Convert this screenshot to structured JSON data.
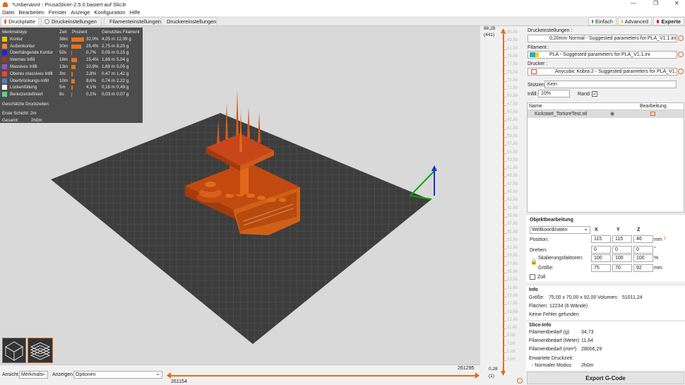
{
  "window": {
    "title": "*Unbenannt - PrusaSlicer-2.5.0 basiert auf Slic3r",
    "minimize": "—",
    "maximize": "❐",
    "close": "✕"
  },
  "menu": [
    "Datei",
    "Bearbeiten",
    "Fenster",
    "Anzeige",
    "Konfiguration",
    "Hilfe"
  ],
  "tabs": [
    "Druckplatte",
    "Druckeinstellungen",
    "Filamenteinstellungen",
    "Druckereinstellungen"
  ],
  "modes": {
    "simple": "Einfach",
    "advanced": "Advanced",
    "expert": "Experte"
  },
  "colors": {
    "accent": "#e06c1a",
    "simple": "#00b000",
    "advanced": "#e6c300",
    "expert": "#e00000",
    "model": "#e06c1a"
  },
  "legend": {
    "headers": [
      "Merkmalstyp",
      "Zeit",
      "Prozent",
      "Genutztes Filament"
    ],
    "rows": [
      {
        "name": "Kontur",
        "color": "#f0c000",
        "time": "38m",
        "pct": "32,0%",
        "fil": "4,05 m",
        "g": "12,09 g",
        "frac": 0.32
      },
      {
        "name": "Außenkontur",
        "color": "#ff7d38",
        "time": "30m",
        "pct": "25,4%",
        "fil": "2,75 m",
        "g": "8,20 g",
        "frac": 0.254
      },
      {
        "name": "Überhängende Kontur",
        "color": "#1f1fff",
        "time": "50s",
        "pct": "0,7%",
        "fil": "0,05 m",
        "g": "0,15 g",
        "frac": 0.007
      },
      {
        "name": "Internes Infill",
        "color": "#b03029",
        "time": "18m",
        "pct": "15,4%",
        "fil": "1,69 m",
        "g": "5,04 g",
        "frac": 0.154
      },
      {
        "name": "Massives Infill",
        "color": "#9654cc",
        "time": "13m",
        "pct": "10,9%",
        "fil": "1,69 m",
        "g": "5,05 g",
        "frac": 0.109
      },
      {
        "name": "Oberes massives Infill",
        "color": "#f04040",
        "time": "3m",
        "pct": "2,8%",
        "fil": "0,47 m",
        "g": "1,42 g",
        "frac": 0.028
      },
      {
        "name": "Überbrückungs-Infill",
        "color": "#4d80ba",
        "time": "10m",
        "pct": "8,6%",
        "fil": "0,74 m",
        "g": "2,22 g",
        "frac": 0.086
      },
      {
        "name": "Lückenfüllung",
        "color": "#ffffff",
        "time": "5m",
        "pct": "4,1%",
        "fil": "0,16 m",
        "g": "0,49 g",
        "frac": 0.041
      },
      {
        "name": "Benutzerdefiniert",
        "color": "#5ed18c",
        "time": "8s",
        "pct": "0,1%",
        "fil": "0,03 m",
        "g": "0,07 g",
        "frac": 0.001
      }
    ],
    "est_title": "Geschätzte Druckzeiten:",
    "first_layer": "Erste Schicht: 2m",
    "total_label": "Gesamt:",
    "total": "2h0m"
  },
  "bottom": {
    "view_label": "Ansicht",
    "view_value": "Merkmals",
    "show_label": "Anzeigen",
    "show_value": "Optionen",
    "slider_max": "261295",
    "slider_min": "261154"
  },
  "layer_slider": {
    "top_value": "88,28",
    "top_layer": "(441)",
    "bottom_value": "0,28",
    "bottom_layer": "(1)",
    "ticks": [
      "85,88",
      "83,88",
      "81,88",
      "79,88",
      "77,88",
      "75,88",
      "73,88",
      "71,88",
      "69,88",
      "67,88",
      "65,88",
      "63,88",
      "61,88",
      "59,88",
      "57,88",
      "55,88",
      "53,88",
      "51,88",
      "49,88",
      "47,88",
      "45,88",
      "43,88",
      "41,88",
      "39,88",
      "37,88",
      "35,88",
      "33,88",
      "31,88",
      "29,88",
      "27,88",
      "25,88",
      "23,88",
      "21,88",
      "19,88",
      "17,88",
      "15,88",
      "13,88",
      "11,88",
      "9,88",
      "7,88",
      "5,88",
      "3,88"
    ]
  },
  "right": {
    "print_label": "Druckeinstellungen :",
    "print_value": "0,20mm Normal - Suggested parameters for PLA_V1.1.ini",
    "filament_label": "Filament :",
    "filament_value": "PLA - Suggested parameters for PLA_V1.1.ini",
    "printer_label": "Drucker :",
    "printer_value": "Anycubic Kobra 2 - Suggested parameters for PLA_V1.1.ini",
    "supports_label": "Stützen:",
    "supports_value": "Kein",
    "infill_label": "Infill:",
    "infill_value": "10%",
    "brim_label": "Rand:",
    "objects_col_name": "Name",
    "objects_col_edit": "Bearbeitung",
    "object_name": "Kickstart_TortureTest.stl",
    "objedit_title": "Objektbearbeitung",
    "coords": "Weltkoordinaten",
    "x": "X",
    "y": "Y",
    "z": "Z",
    "position_label": "Position:",
    "position": [
      "115",
      "115",
      "46"
    ],
    "pos_unit": "mm",
    "rotate_label": "Drehen:",
    "rotate": [
      "0",
      "0",
      "0"
    ],
    "rot_unit": "°",
    "scale_label": "Skalierungsfaktoren:",
    "scale": [
      "100",
      "100",
      "100"
    ],
    "scale_unit": "%",
    "size_label": "Größe:",
    "size": [
      "75",
      "70",
      "92"
    ],
    "size_unit": "mm",
    "inch_label": "Zoll",
    "info_title": "Info",
    "info_size_label": "Größe:",
    "info_size": "75,00 x 70,00 x 92,00",
    "volume_label": "Volumen:",
    "volume": "51011,24",
    "facets_label": "Flächen:",
    "facets": "12234 (6 Wände)",
    "errors": "Keine Fehler gefunden",
    "slice_title": "Slice-Info",
    "fil_g_label": "Filamentbedarf (g)",
    "fil_g": "34,73",
    "fil_m_label": "Filamentbedarf (Meter)",
    "fil_m": "11,64",
    "fil_mm3_label": "Filamentbedarf (mm³)",
    "fil_mm3": "28006,29",
    "est_time_label": "Erwartete Druckzeit:",
    "normal_label": "- Normaler Modus",
    "normal_time": "2h0m",
    "export": "Export G-Code"
  }
}
